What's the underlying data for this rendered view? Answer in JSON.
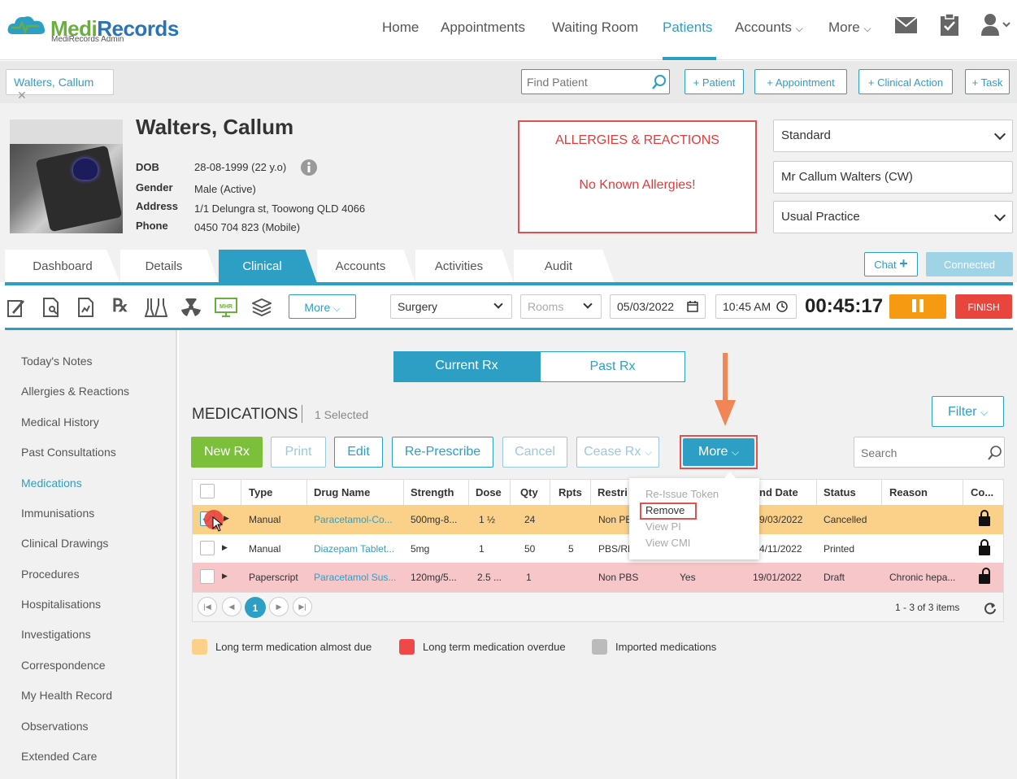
{
  "logo": {
    "part1": "Medi",
    "part2": "Records",
    "subtitle": "MediRecords Admin"
  },
  "nav": {
    "home": "Home",
    "appointments": "Appointments",
    "waiting_room": "Waiting Room",
    "patients": "Patients",
    "accounts": "Accounts",
    "more": "More"
  },
  "strip": {
    "patient_tab": "Walters, Callum",
    "find_placeholder": "Find Patient",
    "add_patient": "+ Patient",
    "add_appointment": "+ Appointment",
    "add_clinical_action": "+ Clinical Action",
    "add_task": "+ Task"
  },
  "patient": {
    "name": "Walters, Callum",
    "dob_label": "DOB",
    "dob": "28-08-1999 (22 y.o)",
    "gender_label": "Gender",
    "gender": "Male (Active)",
    "address_label": "Address",
    "address": "1/1 Delungra st, Toowong QLD 4066",
    "phone_label": "Phone",
    "phone": "0450 704 823 (Mobile)"
  },
  "allergies": {
    "title": "ALLERGIES & REACTIONS",
    "message": "No Known Allergies!"
  },
  "selectors": {
    "billing": "Standard",
    "patient_display": "Mr Callum Walters (CW)",
    "practice": "Usual Practice"
  },
  "tabs": [
    "Dashboard",
    "Details",
    "Clinical",
    "Accounts",
    "Activities",
    "Audit"
  ],
  "chat": {
    "chat_label": "Chat",
    "connected_label": "Connected"
  },
  "toolbar": {
    "more": "More",
    "location": "Surgery",
    "rooms_placeholder": "Rooms",
    "date": "05/03/2022",
    "time": "10:45 AM",
    "timer": "00:45:17",
    "finish": "FINISH"
  },
  "sidebar": [
    "Today's Notes",
    "Allergies & Reactions",
    "Medical History",
    "Past Consultations",
    "Medications",
    "Immunisations",
    "Clinical Drawings",
    "Procedures",
    "Hospitalisations",
    "Investigations",
    "Correspondence",
    "My Health Record",
    "Observations",
    "Extended Care"
  ],
  "rx_toggle": {
    "current": "Current Rx",
    "past": "Past Rx"
  },
  "medications": {
    "title": "MEDICATIONS",
    "selected": "1 Selected",
    "filter": "Filter",
    "buttons": {
      "new_rx": "New Rx",
      "print": "Print",
      "edit": "Edit",
      "re_prescribe": "Re-Prescribe",
      "cancel": "Cancel",
      "cease_rx": "Cease Rx",
      "more": "More"
    },
    "search_placeholder": "Search",
    "columns": [
      "Type",
      "Drug Name",
      "Strength",
      "Dose",
      "Qty",
      "Rpts",
      "Restri",
      "nd Date",
      "Status",
      "Reason",
      "Co..."
    ],
    "rows": [
      {
        "type": "Manual",
        "drug": "Paracetamol-Co...",
        "strength": "500mg-8...",
        "dose": "1 ½",
        "qty": "24",
        "rpts": "",
        "restriction": "Non PE",
        "pbs": "",
        "end_date": "9/03/2022",
        "status": "Cancelled",
        "reason": ""
      },
      {
        "type": "Manual",
        "drug": "Diazepam Tablet...",
        "strength": "5mg",
        "dose": "1",
        "qty": "50",
        "rpts": "5",
        "restriction": "PBS/RP",
        "pbs": "",
        "end_date": "4/11/2022",
        "status": "Printed",
        "reason": ""
      },
      {
        "type": "Paperscript",
        "drug": "Paracetamol Sus...",
        "strength": "120mg/5...",
        "dose": "2.5 ...",
        "qty": "1",
        "rpts": "",
        "restriction": "Non PBS",
        "pbs": "Yes",
        "end_date": "19/01/2022",
        "status": "Draft",
        "reason": "Chronic hepa..."
      }
    ],
    "more_menu": [
      "Re-Issue Token",
      "Remove",
      "View PI",
      "View CMI"
    ],
    "pager": {
      "page": "1",
      "summary": "1 - 3 of 3 items"
    }
  },
  "legend": [
    "Long term medication almost due",
    "Long term medication overdue",
    "Imported medications"
  ],
  "colors": {
    "accent": "#2e9fc4",
    "green": "#7bbf3a",
    "orange": "#f59a11",
    "red": "#e8453c",
    "almost_due": "#fbd18a",
    "overdue": "#f6c6c8"
  }
}
